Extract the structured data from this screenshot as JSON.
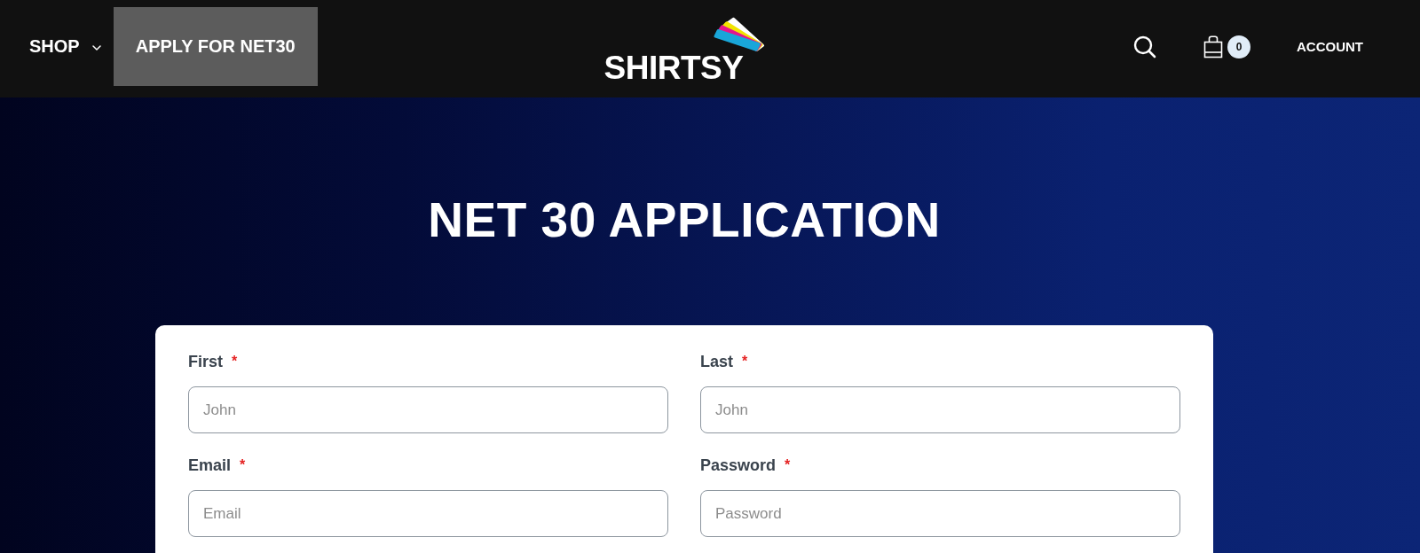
{
  "nav": {
    "items": [
      {
        "label": "SHOP",
        "kind": "dropdown",
        "selected": false
      },
      {
        "label": "APPLY FOR NET30",
        "kind": "link",
        "selected": true
      }
    ],
    "logo": {
      "wordmark": "SHIRTSY"
    },
    "cart": {
      "count": "0"
    },
    "account": {
      "label": "ACCOUNT"
    }
  },
  "hero": {
    "title": "NET 30 APPLICATION"
  },
  "form": {
    "fields": [
      {
        "label": "First",
        "required_mark": "*",
        "placeholder": "John"
      },
      {
        "label": "Last",
        "required_mark": "*",
        "placeholder": "John"
      },
      {
        "label": "Email",
        "required_mark": "*",
        "placeholder": "Email"
      },
      {
        "label": "Password",
        "required_mark": "*",
        "placeholder": "Password"
      }
    ]
  }
}
